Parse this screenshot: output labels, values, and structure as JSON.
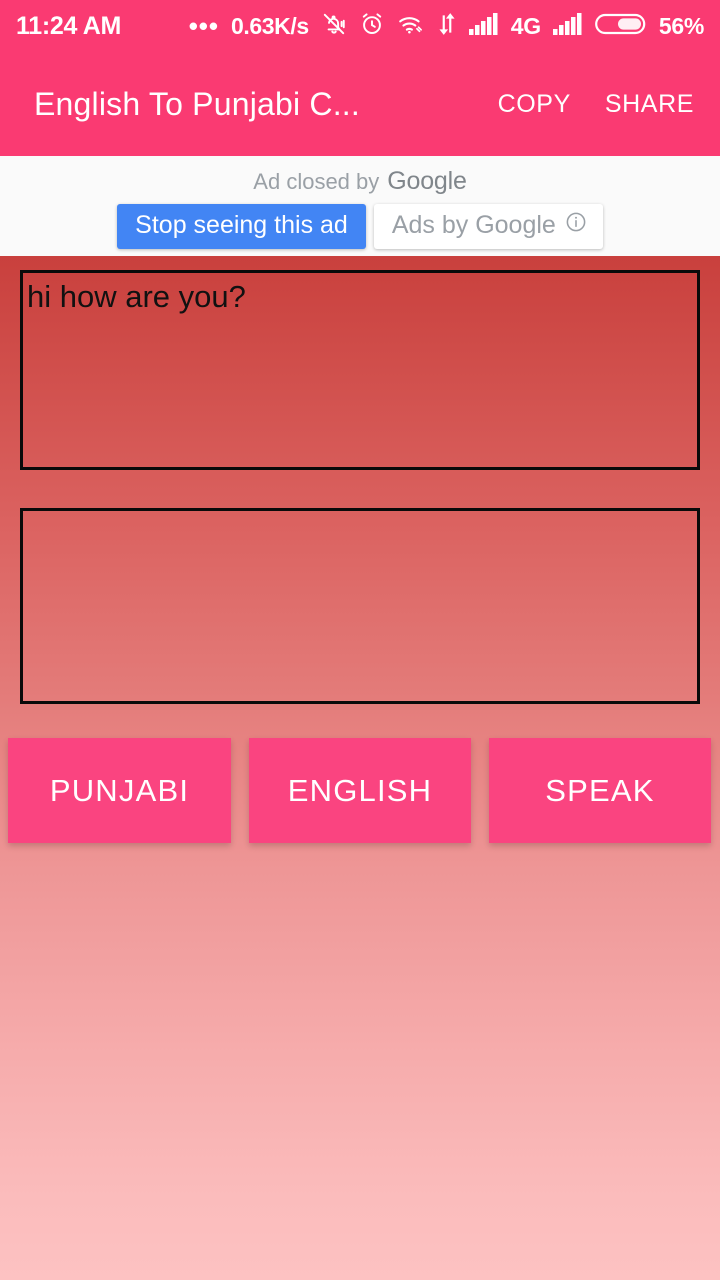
{
  "status_bar": {
    "clock": "11:24 AM",
    "overflow_dots": "•••",
    "network_speed": "0.63K/s",
    "network_type": "4G",
    "battery_percent": "56%",
    "icons": [
      "overflow-dots-icon",
      "network-speed-label",
      "silent-mode-icon",
      "alarm-clock-icon",
      "wifi-icon",
      "data-transfer-icon",
      "signal-bars-icon-1",
      "signal-bars-icon-2",
      "battery-icon"
    ],
    "background_color": "#FA3A72",
    "foreground_color": "#FFFFFF"
  },
  "app_bar": {
    "title": "English To Punjabi C...",
    "copy_label": "COPY",
    "share_label": "SHARE",
    "background_color": "#FA3A72"
  },
  "ad_banner": {
    "closed_prefix": "Ad closed by",
    "brand": "Google",
    "stop_seeing_label": "Stop seeing this ad",
    "ads_by_label": "Ads by Google",
    "info_icon": "info-circle-icon",
    "stop_button_color": "#4285F4",
    "background_color": "#FAFAFA"
  },
  "translator": {
    "input": {
      "value": "hi how are you?",
      "placeholder": ""
    },
    "output": {
      "value": "",
      "placeholder": ""
    },
    "buttons": [
      {
        "id": "punjabi",
        "label": "PUNJABI"
      },
      {
        "id": "english",
        "label": "ENGLISH"
      },
      {
        "id": "speak",
        "label": "SPEAK"
      }
    ],
    "button_color": "#FA4480",
    "background_gradient_top": "#C9403D",
    "background_gradient_bottom": "#FDC2C2"
  }
}
